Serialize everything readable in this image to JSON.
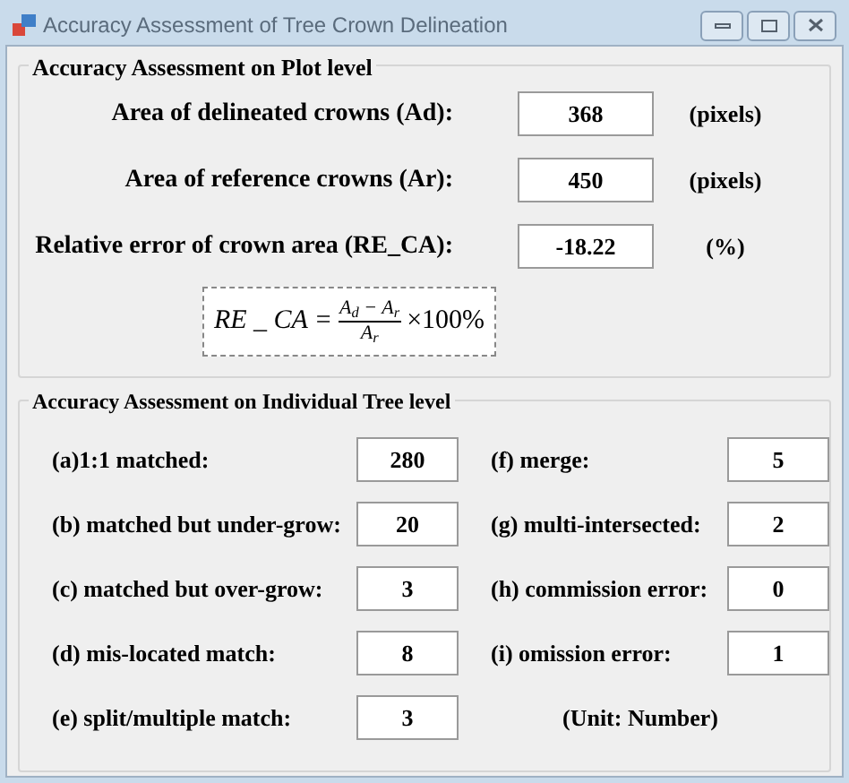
{
  "window": {
    "title": "Accuracy Assessment of Tree Crown Delineation"
  },
  "plot_group": {
    "title": "Accuracy Assessment on Plot level",
    "rows": [
      {
        "label": "Area of delineated crowns (Ad):",
        "value": "368",
        "unit": "(pixels)"
      },
      {
        "label": "Area of reference crowns (Ar):",
        "value": "450",
        "unit": "(pixels)"
      },
      {
        "label": "Relative error of crown area (RE_CA):",
        "value": "-18.22",
        "unit": "(%)"
      }
    ],
    "formula": {
      "lhs": "RE _ CA =",
      "numerator": "A$_{d}$ − A$_{r}$",
      "denominator": "A$_{r}$",
      "factor": "×100%"
    }
  },
  "tree_group": {
    "title": "Accuracy Assessment on Individual Tree level",
    "left": [
      {
        "label": "(a)1:1 matched:",
        "value": "280"
      },
      {
        "label": "(b) matched but under-grow:",
        "value": "20"
      },
      {
        "label": "(c) matched but over-grow:",
        "value": "3"
      },
      {
        "label": "(d) mis-located match:",
        "value": "8"
      },
      {
        "label": "(e) split/multiple match:",
        "value": "3"
      }
    ],
    "right": [
      {
        "label": "(f) merge:",
        "value": "5"
      },
      {
        "label": "(g) multi-intersected:",
        "value": "2"
      },
      {
        "label": "(h) commission error:",
        "value": "0"
      },
      {
        "label": "(i) omission error:",
        "value": "1"
      }
    ],
    "unit_note": "(Unit: Number)"
  }
}
